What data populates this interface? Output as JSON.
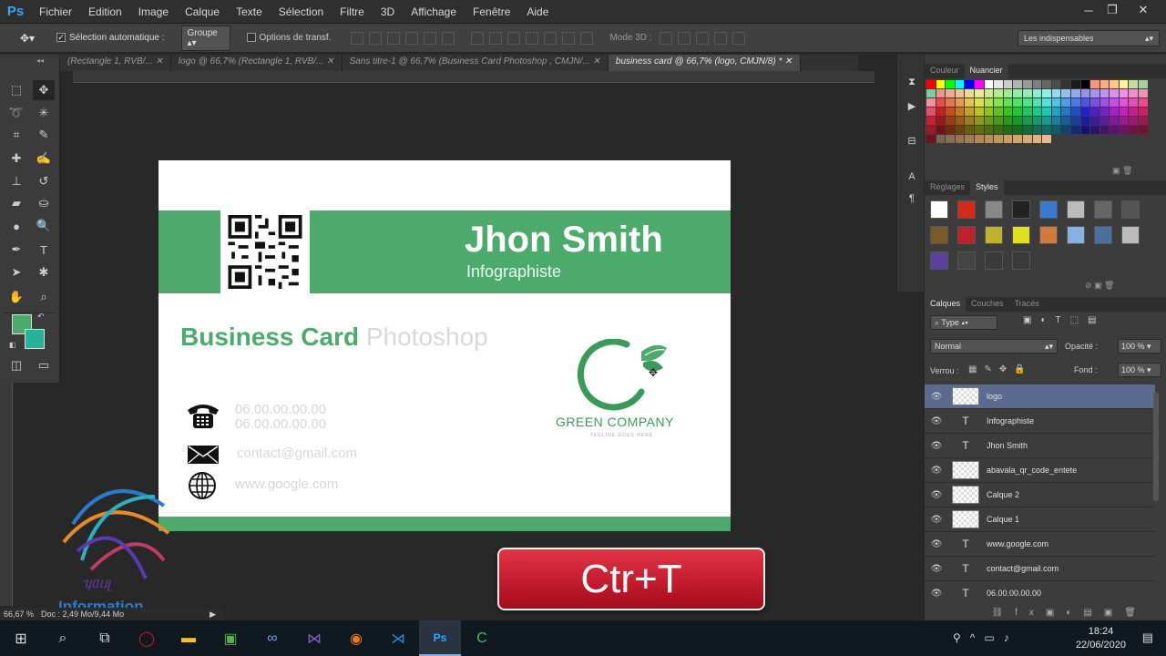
{
  "menubar": {
    "logo": "Ps",
    "items": [
      "Fichier",
      "Edition",
      "Image",
      "Calque",
      "Texte",
      "Sélection",
      "Filtre",
      "3D",
      "Affichage",
      "Fenêtre",
      "Aide"
    ]
  },
  "options": {
    "auto_select_label": "Sélection automatique :",
    "group_value": "Groupe",
    "transform_label": "Options de transf.",
    "mode3d_label": "Mode 3D :",
    "workspace": "Les indispensables"
  },
  "tabs": [
    {
      "label": "(Rectangle 1, RVB/..."
    },
    {
      "label": "logo @ 66,7% (Rectangle 1, RVB/..."
    },
    {
      "label": "Sans titre-1 @ 66,7% (Business Card Photoshop , CMJN/..."
    },
    {
      "label": "business card @ 66,7% (logo, CMJN/8) *"
    }
  ],
  "card": {
    "name": "Jhon Smith",
    "role": "Infographiste",
    "title_bold": "Business Card",
    "title_light": "Photoshop",
    "phone1": "06.00.00.00.00",
    "phone2": "06.00.00.00.00",
    "email": "contact@gmail.com",
    "web": "www.google.com",
    "logo_text": "GREEN COMPANY",
    "logo_sub": "TAGLINE GOES HERE",
    "brand_color": "#4cab6c"
  },
  "overlay": {
    "shortcut": "Ctr+T",
    "watermark": "Information"
  },
  "status": {
    "zoom": "66,67 %",
    "doc": "Doc : 2,49 Mo/9,44 Mo"
  },
  "panels": {
    "color_tabs": [
      "Couleur",
      "Nuancier"
    ],
    "adjust_tabs": [
      "Réglages",
      "Styles"
    ],
    "layer_tabs": [
      "Calques",
      "Couches",
      "Tracés"
    ],
    "filter_kind": "Type",
    "blend_mode": "Normal",
    "opacity_label": "Opacité :",
    "opacity": "100 %",
    "lock_label": "Verrou :",
    "fill_label": "Fond :",
    "fill": "100 %",
    "layers": [
      {
        "name": "logo",
        "kind": "smart",
        "selected": true
      },
      {
        "name": "Infographiste",
        "kind": "text"
      },
      {
        "name": "Jhon Smith",
        "kind": "text"
      },
      {
        "name": "abavala_qr_code_entete",
        "kind": "image"
      },
      {
        "name": "Calque 2",
        "kind": "image"
      },
      {
        "name": "Calque 1",
        "kind": "image"
      },
      {
        "name": "www.google.com",
        "kind": "text"
      },
      {
        "name": "contact@gmail.com",
        "kind": "text"
      },
      {
        "name": "06.00.00.00.00",
        "kind": "text"
      }
    ]
  },
  "taskbar": {
    "time": "18:24",
    "date": "22/06/2020"
  }
}
